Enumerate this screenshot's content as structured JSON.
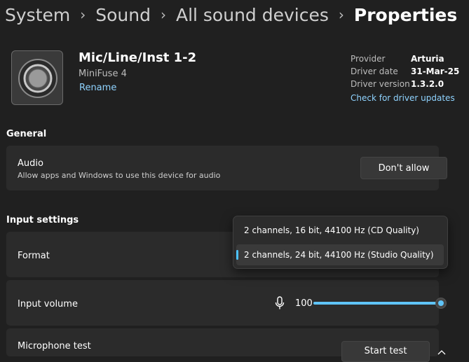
{
  "breadcrumb": {
    "items": [
      "System",
      "Sound",
      "All sound devices",
      "Properties"
    ],
    "separator": "›"
  },
  "device": {
    "name": "Mic/Line/Inst 1-2",
    "subtitle": "MiniFuse 4",
    "rename_link": "Rename",
    "icon": "speaker-icon"
  },
  "driver": {
    "provider_label": "Provider",
    "provider_value": "Arturia",
    "date_label": "Driver date",
    "date_value": "31-Mar-25",
    "version_label": "Driver version",
    "version_value": "1.3.2.0",
    "update_link": "Check for driver updates"
  },
  "general": {
    "heading": "General",
    "audio_title": "Audio",
    "audio_desc": "Allow apps and Windows to use this device for audio",
    "audio_button": "Don't allow"
  },
  "input": {
    "heading": "Input settings",
    "format_label": "Format",
    "format_options": [
      "2 channels, 16 bit, 44100 Hz (CD Quality)",
      "2 channels, 24 bit, 44100 Hz (Studio Quality)"
    ],
    "format_selected_index": 1,
    "volume_label": "Input volume",
    "volume_value": "100",
    "volume_level": 1.0,
    "mic_test_label": "Microphone test",
    "mic_test_button": "Start test"
  },
  "colors": {
    "accent": "#4cc2ff",
    "background": "#202020",
    "card": "#2b2b2b",
    "link": "#8fd3ff"
  }
}
